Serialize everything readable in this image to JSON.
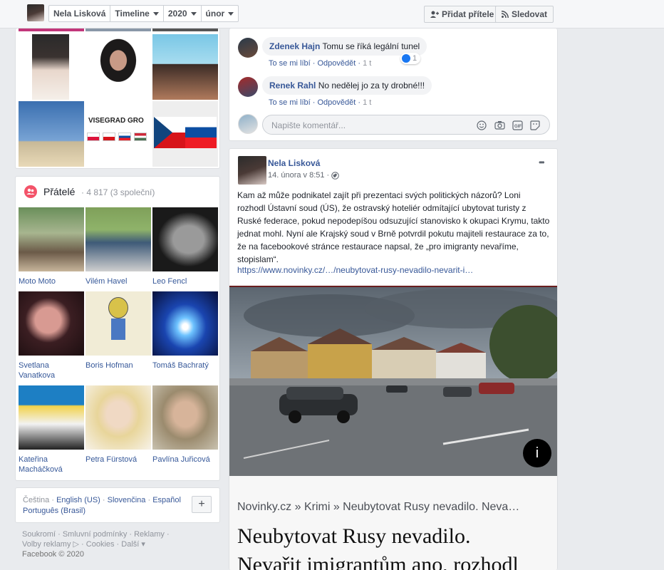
{
  "header": {
    "profile_name": "Nela Lisková",
    "section": "Timeline",
    "year": "2020",
    "month": "únor",
    "add_friend": "Přidat přítele",
    "follow": "Sledovat"
  },
  "photos": {
    "visegrad_caption": "VISEGRAD GRO"
  },
  "friends": {
    "title": "Přátelé",
    "count": "· 4 817 (3 společní)",
    "items": [
      {
        "name": "Moto Moto"
      },
      {
        "name": "Vilém Havel"
      },
      {
        "name": "Leo Fencl"
      },
      {
        "name": "Svetlana Vanatkova"
      },
      {
        "name": "Boris Hofman"
      },
      {
        "name": "Tomáš Bachratý"
      },
      {
        "name": "Kateřina Macháčková"
      },
      {
        "name": "Petra Fürstová"
      },
      {
        "name": "Pavlína Juřicová"
      }
    ]
  },
  "languages": {
    "current": "Čeština",
    "sep1": " · ",
    "lang1": "English (US)",
    "lang2": "Slovenčina",
    "lang3": "Español",
    "lang4": "Português (Brasil)",
    "add_button": "+"
  },
  "footer": {
    "line1": "Soukromí · Smluvní podmínky · Reklamy ·",
    "line2": "Volby reklamy ▷ · Cookies · Další ▾",
    "line3": "Facebook © 2020"
  },
  "comments": [
    {
      "author": "Zdenek Hajn",
      "text": "Tomu se říká legální tunel",
      "like": "To se mi líbí",
      "reply": "Odpovědět",
      "time": "1 t",
      "reactions": "1"
    },
    {
      "author": "Renek Rahl",
      "text": "No nedělej jo za ty drobné!!!",
      "like": "To se mi líbí",
      "reply": "Odpovědět",
      "time": "1 t"
    }
  ],
  "comment_input": {
    "placeholder": "Napište komentář..."
  },
  "post": {
    "author": "Nela Lisková",
    "date": "14. února v 8:51 ·",
    "more": "•••",
    "text": "Kam až může podnikatel zajít při prezentaci svých politických názorů? Loni rozhodl Ústavní soud (ÚS), že ostravský hoteliér odmítající ubytovat turisty z Ruské federace, pokud nepodepíšou odsuzující stanovisko k okupaci Krymu, takto jednat mohl. Nyní ale Krajský soud v Brně potvrdil pokutu majiteli restaurace za to, že na facebookové stránce restaurace napsal, že „pro imigranty nevaříme, stopislam“.",
    "link": "https://www.novinky.cz/…/neubytovat-rusy-nevadilo-nevarit-i…",
    "info_button": "i",
    "preview_breadcrumb": "Novinky.cz » Krimi » Neubytovat Rusy nevadilo. Neva…",
    "preview_headline_1": "Neubytovat Rusy nevadilo.",
    "preview_headline_2": "Nevařit imigrantům ano, rozhodl"
  },
  "colors": {
    "link": "#385898",
    "bg": "#e9ebee",
    "bubble": "#f2f3f5"
  }
}
